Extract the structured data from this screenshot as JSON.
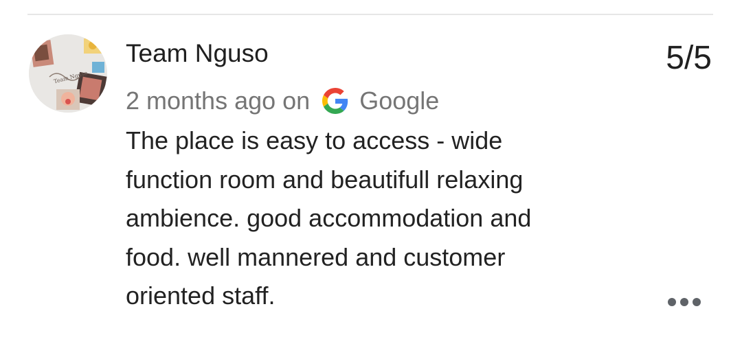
{
  "review": {
    "author_name": "Team Nguso",
    "rating": "5/5",
    "time_ago": "2 months ago on",
    "source_name": "Google",
    "text_lines": [
      "The place is easy to access - wide",
      "function room and beautifull relaxing",
      "ambience. good accommodation and",
      "food. well mannered and customer",
      "oriented staff."
    ],
    "avatar_caption": "Team Nguso"
  },
  "icons": {
    "source": "google-g-icon",
    "more": "more-horizontal-icon"
  },
  "colors": {
    "google_blue": "#4285F4",
    "google_red": "#EA4335",
    "google_yellow": "#FBBC05",
    "google_green": "#34A853",
    "secondary_text": "#757575",
    "primary_text": "#222222"
  }
}
